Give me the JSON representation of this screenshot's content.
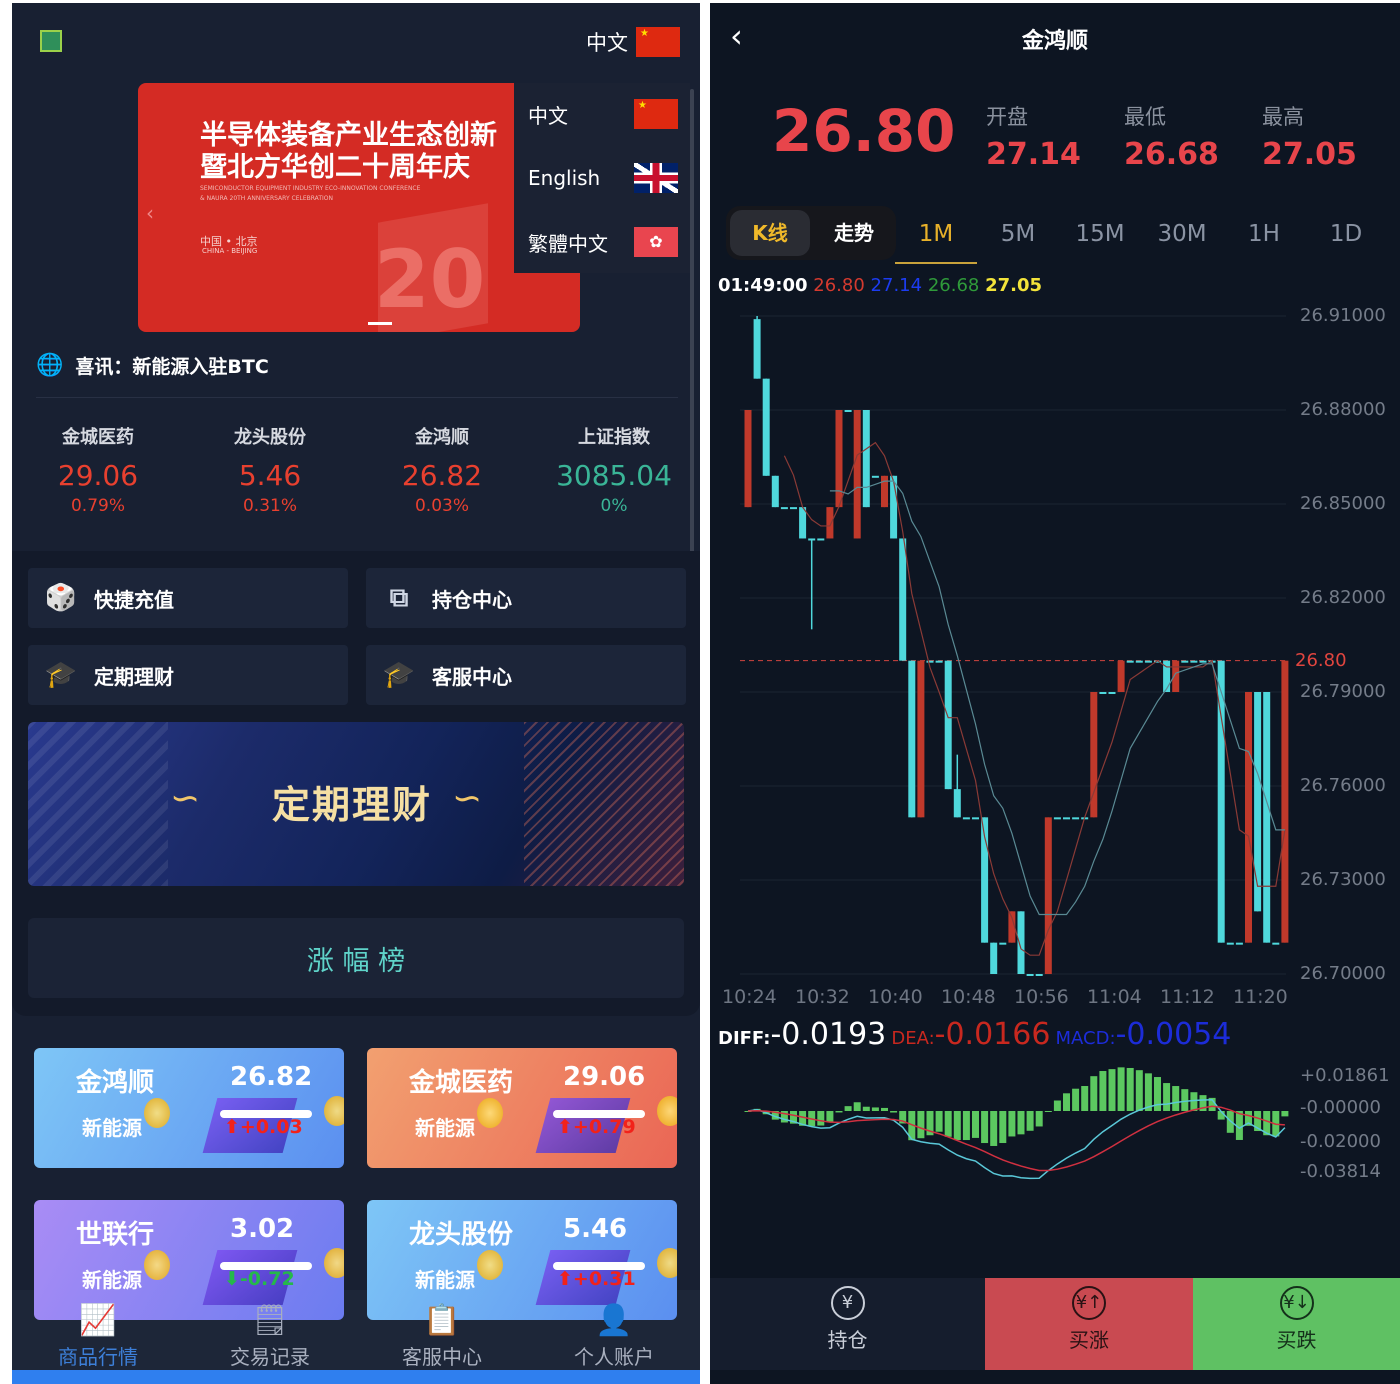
{
  "left": {
    "language": {
      "current": "中文",
      "current_flag": "cn",
      "options": [
        {
          "label": "中文",
          "flag": "cn"
        },
        {
          "label": "English",
          "flag": "uk"
        },
        {
          "label": "繁體中文",
          "flag": "hk"
        }
      ]
    },
    "banner": {
      "title_line1": "半导体装备产业生态创新",
      "title_line2": "暨北方华创二十周年庆",
      "en_line1": "SEMICONDUCTOR EQUIPMENT INDUSTRY ECO-INNOVATION CONFERENCE",
      "en_line2": "& NAURA 20TH ANNIVERSARY CELEBRATION",
      "place_cn": "中国 • 北京",
      "place_en": "CHINA - BEIJING",
      "badge": "20",
      "color": "#d42b24"
    },
    "notice": "喜讯：新能源入驻BTC",
    "tickers": [
      {
        "name": "金城医药",
        "price": "29.06",
        "change": "0.79%",
        "color": "#e8402f"
      },
      {
        "name": "龙头股份",
        "price": "5.46",
        "change": "0.31%",
        "color": "#e8402f"
      },
      {
        "name": "金鸿顺",
        "price": "26.82",
        "change": "0.03%",
        "color": "#e8402f"
      },
      {
        "name": "上证指数",
        "price": "3085.04",
        "change": "0%",
        "color": "#3ab597"
      }
    ],
    "quick": [
      {
        "label": "快捷充值",
        "icon": "recharge-icon"
      },
      {
        "label": "持仓中心",
        "icon": "position-icon"
      },
      {
        "label": "定期理财",
        "icon": "finance-icon"
      },
      {
        "label": "客服中心",
        "icon": "service-icon"
      }
    ],
    "promo": "定期理财",
    "ranking": "涨 幅 榜",
    "cards": [
      {
        "name": "金鸿顺",
        "tag": "新能源",
        "price": "26.82",
        "change": "+0.03",
        "dir": "up"
      },
      {
        "name": "金城医药",
        "tag": "新能源",
        "price": "29.06",
        "change": "+0.79",
        "dir": "up"
      },
      {
        "name": "世联行",
        "tag": "新能源",
        "price": "3.02",
        "change": "-0.72",
        "dir": "down"
      },
      {
        "name": "龙头股份",
        "tag": "新能源",
        "price": "5.46",
        "change": "+0.31",
        "dir": "up"
      }
    ],
    "nav": [
      {
        "label": "商品行情",
        "icon": "chart-icon",
        "active": true
      },
      {
        "label": "交易记录",
        "icon": "record-icon"
      },
      {
        "label": "客服中心",
        "icon": "service-doc-icon"
      },
      {
        "label": "个人账户",
        "icon": "user-icon"
      }
    ],
    "accent": "#2f7fef"
  },
  "right": {
    "title": "金鸿顺",
    "price": "26.80",
    "stats": [
      {
        "label": "开盘",
        "value": "27.14"
      },
      {
        "label": "最低",
        "value": "26.68"
      },
      {
        "label": "最高",
        "value": "27.05"
      }
    ],
    "mode_tabs": [
      {
        "label": "K线",
        "active": true
      },
      {
        "label": "走势"
      }
    ],
    "periods": [
      {
        "label": "1M",
        "active": true
      },
      {
        "label": "5M"
      },
      {
        "label": "15M"
      },
      {
        "label": "30M"
      },
      {
        "label": "1H"
      },
      {
        "label": "1D"
      }
    ],
    "info": {
      "time": "01:49:00",
      "v1": "26.80",
      "v2": "27.14",
      "v3": "26.68",
      "v4": "27.05"
    },
    "macd": {
      "diff_label": "DIFF:",
      "diff": "-0.0193",
      "dea_label": "DEA:",
      "dea": "-0.0166",
      "macd_label": "MACD:",
      "macd": "-0.0054"
    },
    "actions": [
      {
        "label": "持仓",
        "icon": "coins-icon"
      },
      {
        "label": "买涨",
        "icon": "yuan-up-icon",
        "color": "#c94a51"
      },
      {
        "label": "买跌",
        "icon": "yuan-down-icon",
        "color": "#5fc163"
      }
    ]
  },
  "chart_data": {
    "type": "candlestick",
    "y_ticks": [
      "26.91000",
      "26.88000",
      "26.85000",
      "26.82000",
      "26.79000",
      "26.76000",
      "26.73000",
      "26.70000"
    ],
    "ylim": [
      26.7,
      26.91
    ],
    "x_ticks": [
      "10:24",
      "10:32",
      "10:40",
      "10:48",
      "10:56",
      "11:04",
      "11:12",
      "11:20"
    ],
    "current_price_line": "26.80",
    "up_color": "#c0392b",
    "down_color": "#4fd8dc",
    "candles_ohlc": [
      [
        26.849,
        26.88,
        26.849,
        26.88
      ],
      [
        26.909,
        26.91,
        26.89,
        26.89
      ],
      [
        26.89,
        26.89,
        26.859,
        26.859
      ],
      [
        26.859,
        26.859,
        26.849,
        26.849
      ],
      [
        26.849,
        26.849,
        26.849,
        26.849
      ],
      [
        26.849,
        26.849,
        26.849,
        26.849
      ],
      [
        26.849,
        26.849,
        26.839,
        26.839
      ],
      [
        26.839,
        26.839,
        26.81,
        26.839
      ],
      [
        26.839,
        26.839,
        26.839,
        26.839
      ],
      [
        26.839,
        26.849,
        26.839,
        26.849
      ],
      [
        26.849,
        26.88,
        26.849,
        26.88
      ],
      [
        26.88,
        26.88,
        26.88,
        26.88
      ],
      [
        26.839,
        26.88,
        26.839,
        26.88
      ],
      [
        26.88,
        26.88,
        26.849,
        26.849
      ],
      [
        26.859,
        26.859,
        26.859,
        26.859
      ],
      [
        26.849,
        26.859,
        26.849,
        26.859
      ],
      [
        26.859,
        26.859,
        26.839,
        26.839
      ],
      [
        26.839,
        26.839,
        26.8,
        26.8
      ],
      [
        26.8,
        26.8,
        26.75,
        26.75
      ],
      [
        26.75,
        26.8,
        26.75,
        26.8
      ],
      [
        26.8,
        26.8,
        26.8,
        26.8
      ],
      [
        26.8,
        26.8,
        26.8,
        26.8
      ],
      [
        26.8,
        26.8,
        26.759,
        26.759
      ],
      [
        26.759,
        26.77,
        26.75,
        26.75
      ],
      [
        26.75,
        26.75,
        26.75,
        26.75
      ],
      [
        26.75,
        26.75,
        26.75,
        26.75
      ],
      [
        26.75,
        26.75,
        26.71,
        26.71
      ],
      [
        26.71,
        26.71,
        26.7,
        26.7
      ],
      [
        26.71,
        26.71,
        26.71,
        26.71
      ],
      [
        26.71,
        26.72,
        26.71,
        26.72
      ],
      [
        26.72,
        26.72,
        26.7,
        26.7
      ],
      [
        26.7,
        26.7,
        26.7,
        26.7
      ],
      [
        26.7,
        26.7,
        26.7,
        26.7
      ],
      [
        26.7,
        26.75,
        26.7,
        26.75
      ],
      [
        26.75,
        26.75,
        26.75,
        26.75
      ],
      [
        26.75,
        26.75,
        26.75,
        26.75
      ],
      [
        26.75,
        26.75,
        26.75,
        26.75
      ],
      [
        26.75,
        26.75,
        26.75,
        26.75
      ],
      [
        26.75,
        26.79,
        26.75,
        26.79
      ],
      [
        26.79,
        26.79,
        26.79,
        26.79
      ],
      [
        26.79,
        26.79,
        26.79,
        26.79
      ],
      [
        26.79,
        26.8,
        26.79,
        26.8
      ],
      [
        26.8,
        26.8,
        26.8,
        26.8
      ],
      [
        26.8,
        26.8,
        26.8,
        26.8
      ],
      [
        26.8,
        26.8,
        26.8,
        26.8
      ],
      [
        26.8,
        26.8,
        26.8,
        26.8
      ],
      [
        26.8,
        26.8,
        26.79,
        26.79
      ],
      [
        26.79,
        26.8,
        26.79,
        26.8
      ],
      [
        26.8,
        26.8,
        26.8,
        26.8
      ],
      [
        26.8,
        26.8,
        26.8,
        26.8
      ],
      [
        26.8,
        26.8,
        26.8,
        26.8
      ],
      [
        26.8,
        26.8,
        26.8,
        26.8
      ],
      [
        26.8,
        26.8,
        26.71,
        26.71
      ],
      [
        26.71,
        26.71,
        26.71,
        26.71
      ],
      [
        26.71,
        26.71,
        26.71,
        26.71
      ],
      [
        26.71,
        26.79,
        26.71,
        26.79
      ],
      [
        26.79,
        26.79,
        26.72,
        26.72
      ],
      [
        26.79,
        26.79,
        26.71,
        26.71
      ],
      [
        26.71,
        26.71,
        26.71,
        26.71
      ],
      [
        26.71,
        26.8,
        26.71,
        26.8
      ]
    ],
    "macd_ticks": [
      "+0.01861",
      "-0.00000",
      "-0.02000",
      "-0.03814"
    ],
    "macd_ylim": [
      -0.03814,
      0.01861
    ]
  }
}
